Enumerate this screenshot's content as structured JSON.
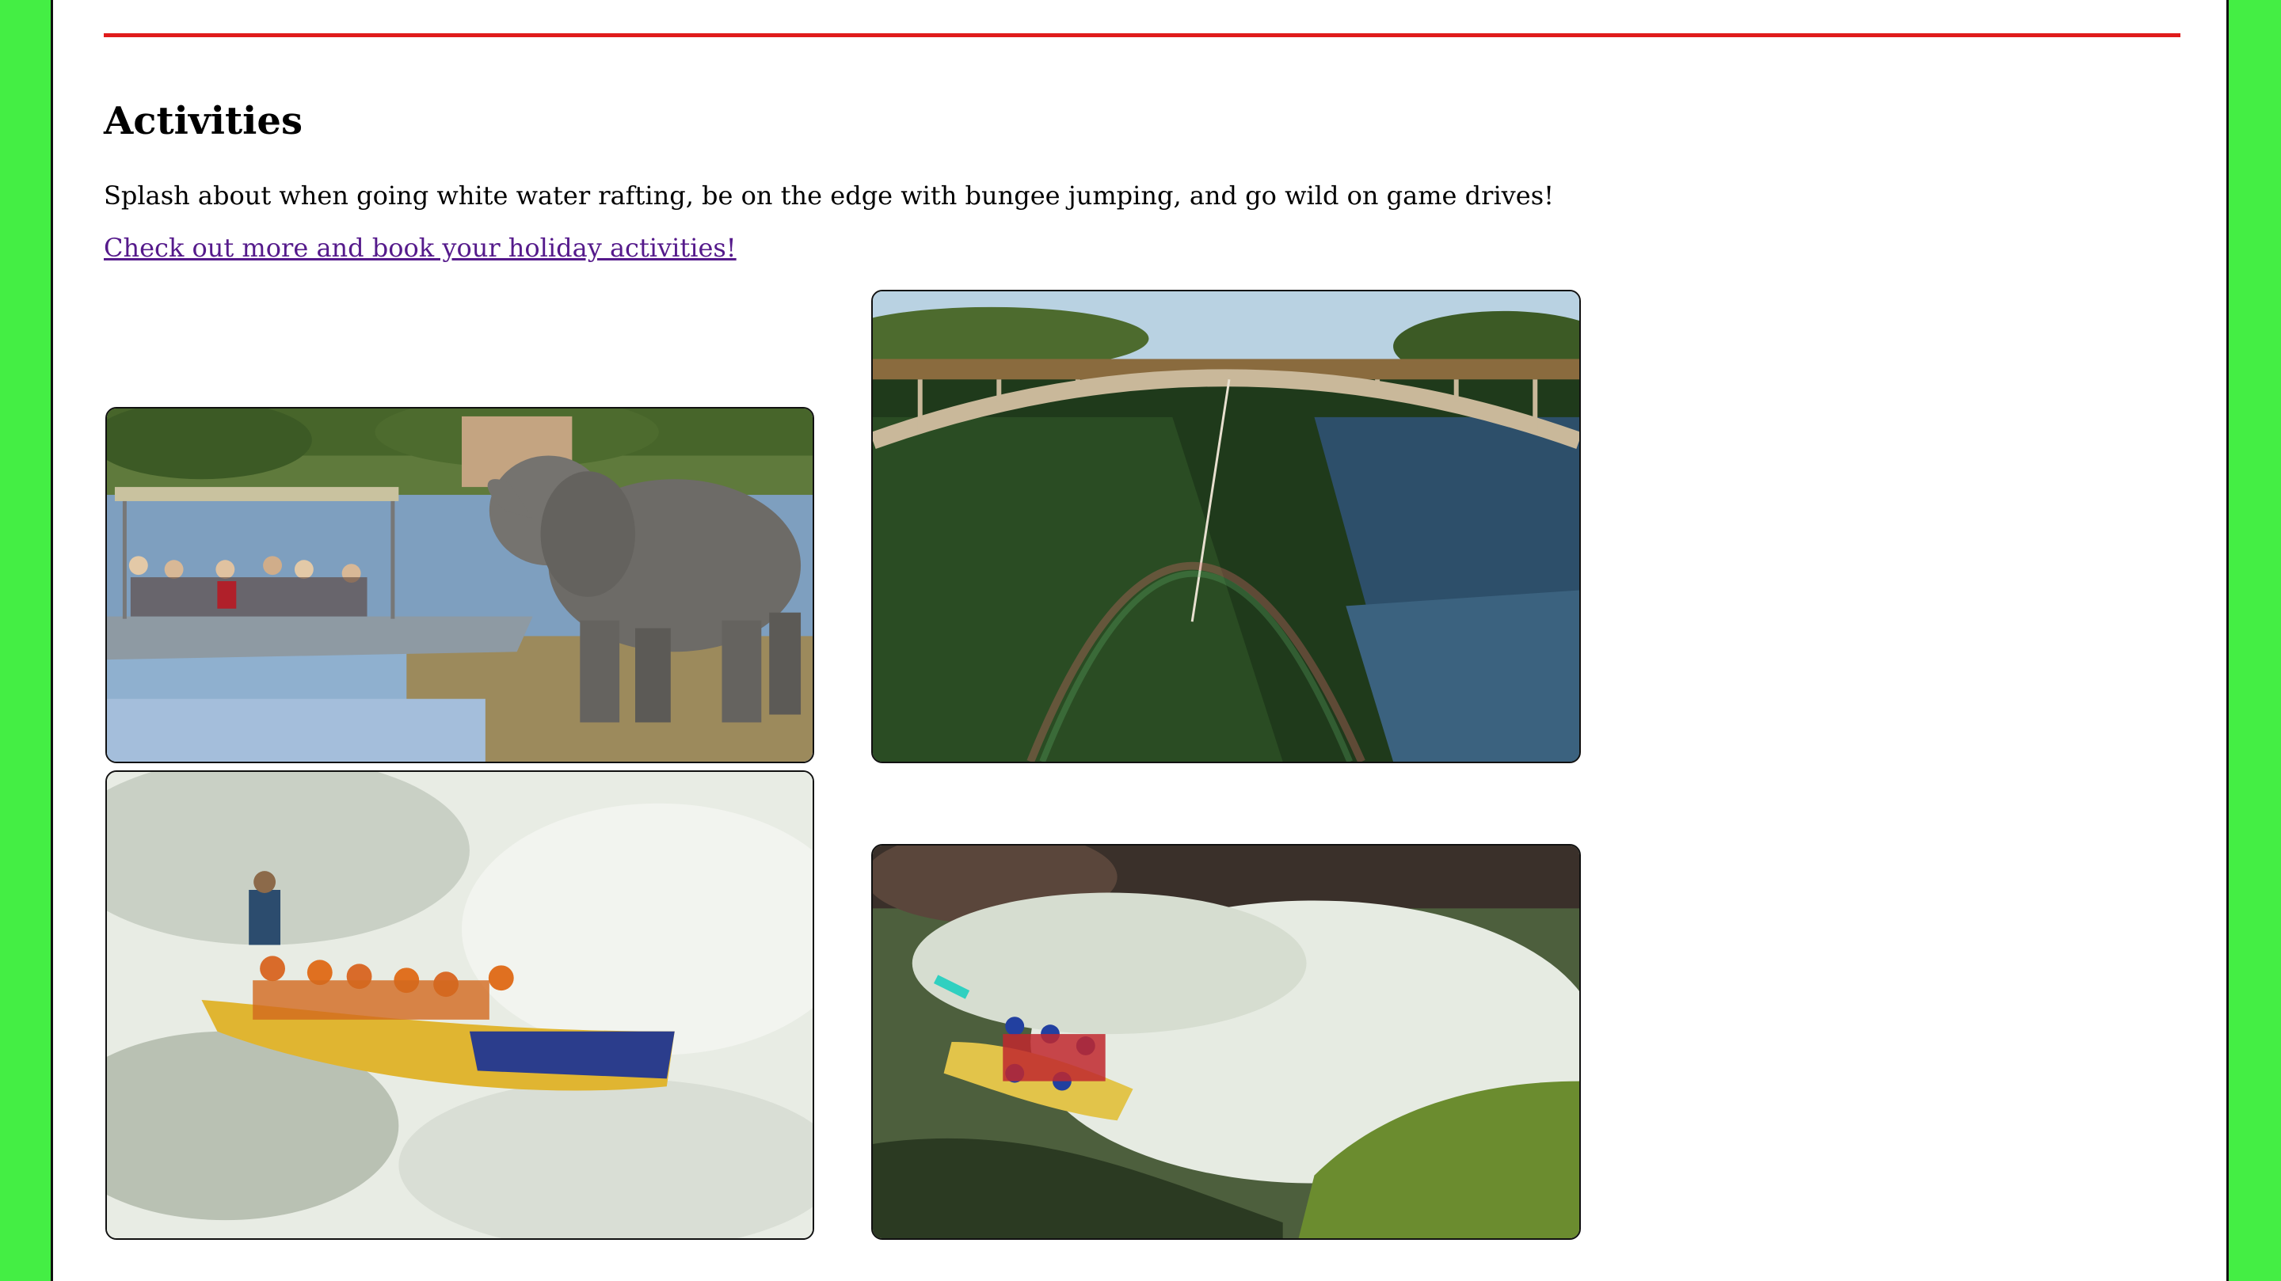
{
  "section": {
    "heading": "Activities",
    "intro": "Splash about when going white water rafting, be on the edge with bungee jumping, and go wild on game drives!",
    "link_text": "Check out more and book your holiday activities!"
  },
  "colors": {
    "page_background": "#44ee44",
    "content_background": "#ffffff",
    "divider": "#e01b1b",
    "link": "#551a8b"
  },
  "gallery": [
    {
      "subject": "elephant drinking beside safari boat on river"
    },
    {
      "subject": "bungee jumper on bridge over gorge with rainbow"
    },
    {
      "subject": "yellow raft crew in white water rapids"
    },
    {
      "subject": "raft with helmeted crew paddling through river rapids"
    }
  ]
}
